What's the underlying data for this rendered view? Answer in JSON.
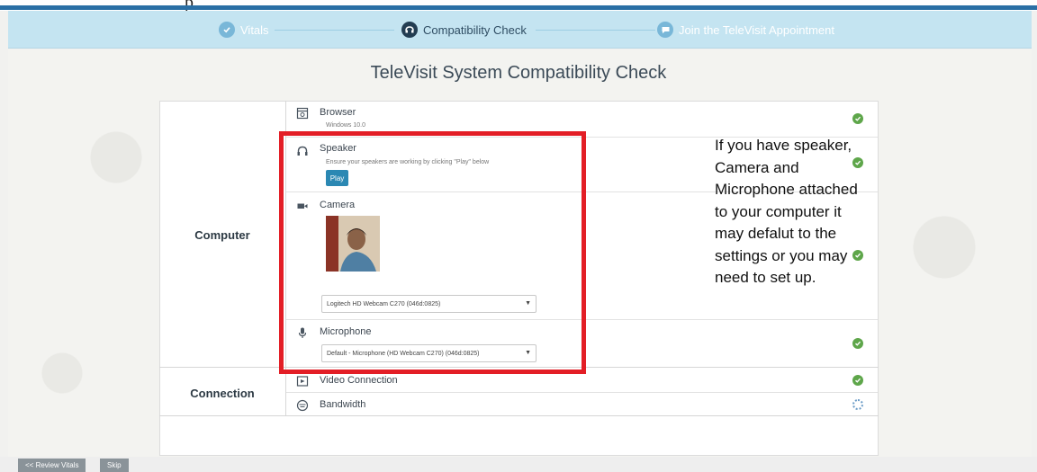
{
  "stepper": {
    "steps": [
      {
        "label": "Vitals",
        "state": "done",
        "icon": "check-circle-icon"
      },
      {
        "label": "Compatibility Check",
        "state": "active",
        "icon": "compatibility-icon"
      },
      {
        "label": "Join the TeleVisit Appointment",
        "state": "future",
        "icon": "chat-bubble-icon"
      }
    ]
  },
  "page": {
    "title": "TeleVisit System Compatibility Check"
  },
  "groups": {
    "computer": "Computer",
    "connection": "Connection"
  },
  "checks": {
    "browser": {
      "title": "Browser",
      "subtitle": "Windows 10.0",
      "icon": "browser-icon",
      "status": "ok"
    },
    "speaker": {
      "title": "Speaker",
      "subtitle": "Ensure your speakers are working by clicking \"Play\" below",
      "icon": "headphones-icon",
      "status": "ok",
      "play_label": "Play"
    },
    "camera": {
      "title": "Camera",
      "icon": "video-camera-icon",
      "status": "ok",
      "selected_device": "Logitech HD Webcam C270 (046d:0825)"
    },
    "microphone": {
      "title": "Microphone",
      "icon": "microphone-icon",
      "status": "ok",
      "selected_device": "Default - Microphone (HD Webcam C270) (046d:0825)"
    },
    "video_connection": {
      "title": "Video Connection",
      "icon": "video-connection-icon",
      "status": "ok"
    },
    "bandwidth": {
      "title": "Bandwidth",
      "icon": "bandwidth-icon",
      "status": "loading"
    }
  },
  "annotation": {
    "text": "If you have speaker, Camera and Microphone attached to your computer it may defalut to the settings or you may need to set up."
  },
  "footer": {
    "review_label": "<< Review Vitals",
    "skip_label": "Skip"
  },
  "colors": {
    "brand_blue": "#2a6fa5",
    "stepper_bg": "#c4e4f1",
    "ok_green": "#5ea64a",
    "play_button": "#2b88b3",
    "highlight_red": "#e31e26"
  }
}
